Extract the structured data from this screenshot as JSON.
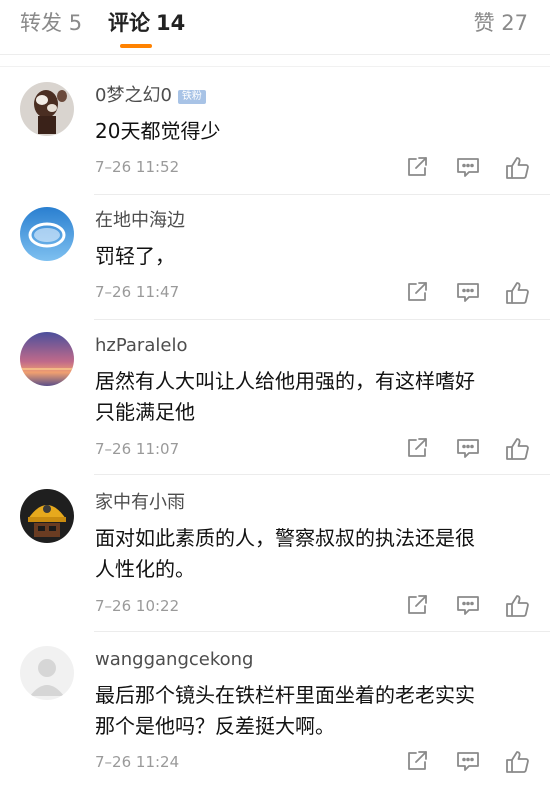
{
  "tabs": {
    "repost_label": "转发",
    "repost_count": "5",
    "comments_label": "评论",
    "comments_count": "14",
    "like_label": "赞",
    "like_count": "27"
  },
  "comments": [
    {
      "username": "0梦之幻0",
      "badge": "铁粉",
      "content": "20天都觉得少",
      "time": "7–26 11:52"
    },
    {
      "username": "在地中海边",
      "content": "罚轻了，",
      "time": "7–26 11:47"
    },
    {
      "username": "hzParalelo",
      "content_line1": "居然有人大叫让人给他用强的，有这样嗜好",
      "content_line2": "只能满足他",
      "time": "7–26 11:07"
    },
    {
      "username": "家中有小雨",
      "content_line1": "面对如此素质的人，警察叔叔的执法还是很",
      "content_line2": "人性化的。",
      "time": "7–26 10:22"
    },
    {
      "username": "wanggangcekong",
      "content_line1": "最后那个镜头在铁栏杆里面坐着的老老实实",
      "content_line2": "那个是他吗？反差挺大啊。",
      "time": "7–26 11:24"
    }
  ],
  "icons": {
    "share": "share-icon",
    "reply": "comment-icon",
    "like": "thumbs-up-icon"
  },
  "colors": {
    "accent": "#ff8200",
    "badge": "#a8c3e6"
  }
}
